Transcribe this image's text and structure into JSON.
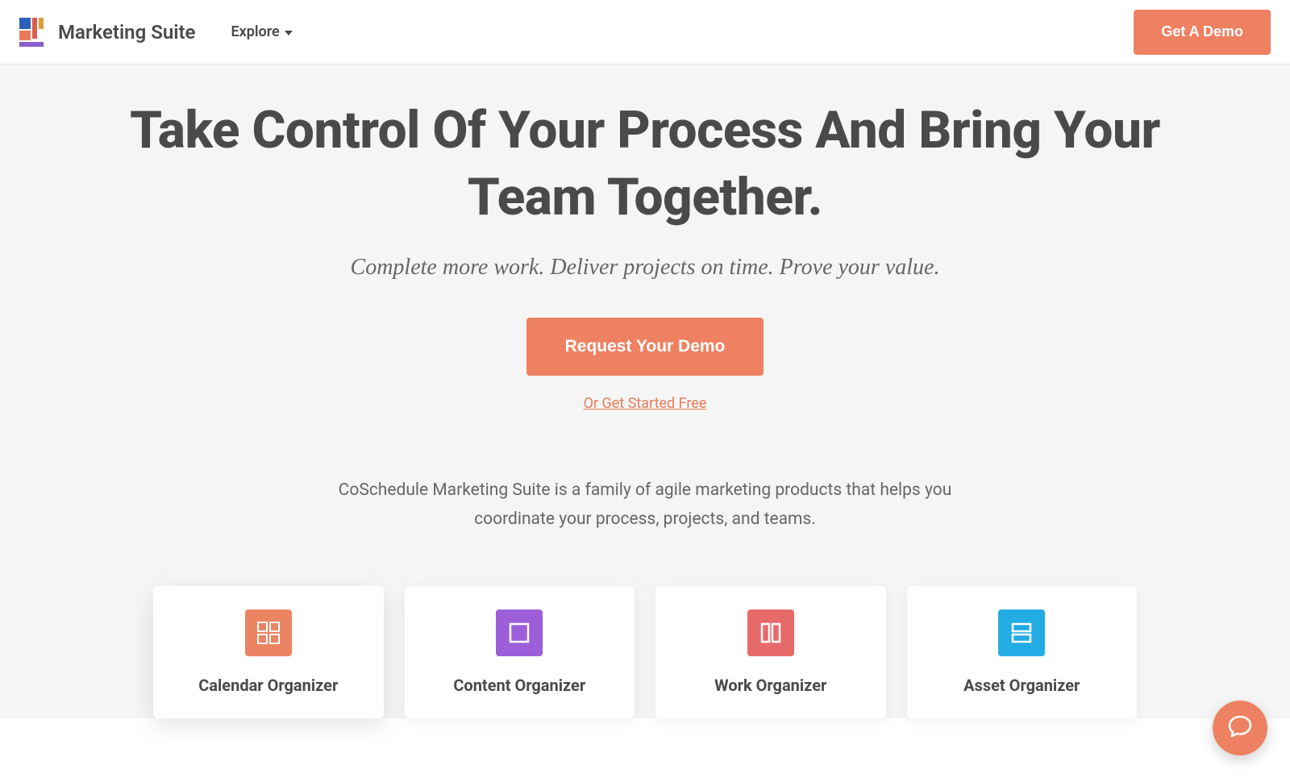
{
  "header": {
    "brand": "Marketing Suite",
    "nav_explore": "Explore",
    "cta": "Get A Demo"
  },
  "hero": {
    "title": "Take Control Of Your Process And Bring Your Team Together.",
    "subtitle": "Complete more work. Deliver projects on time. Prove your value.",
    "cta": "Request Your Demo",
    "alt_link": "Or Get Started Free",
    "description": "CoSchedule Marketing Suite is a family of agile marketing products that helps you coordinate your process, projects, and teams."
  },
  "cards": [
    {
      "title": "Calendar Organizer",
      "color": "#eb8463",
      "icon": "grid4"
    },
    {
      "title": "Content Organizer",
      "color": "#9c5fd9",
      "icon": "square"
    },
    {
      "title": "Work Organizer",
      "color": "#e76a6a",
      "icon": "columns2"
    },
    {
      "title": "Asset Organizer",
      "color": "#23ace3",
      "icon": "rows2"
    }
  ],
  "chat": {
    "label": "chat"
  }
}
